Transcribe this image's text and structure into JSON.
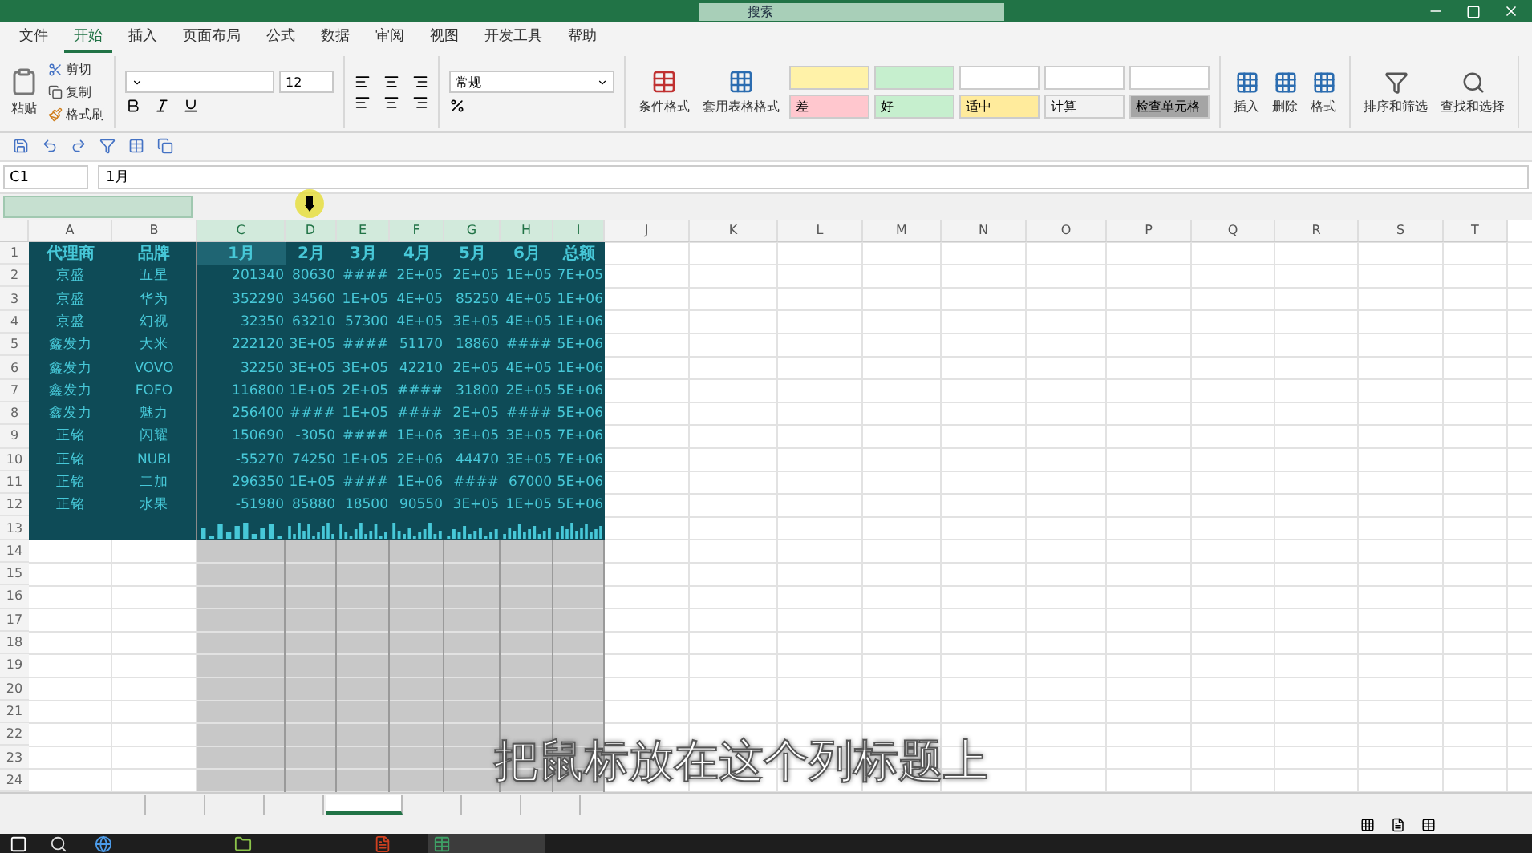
{
  "title_bar": {
    "search_placeholder": "搜索"
  },
  "ribbon_tabs": [
    {
      "label": "文件",
      "selected": false
    },
    {
      "label": "开始",
      "selected": true
    },
    {
      "label": "插入",
      "selected": false
    },
    {
      "label": "页面布局",
      "selected": false
    },
    {
      "label": "公式",
      "selected": false
    },
    {
      "label": "数据",
      "selected": false
    },
    {
      "label": "审阅",
      "selected": false
    },
    {
      "label": "视图",
      "selected": false
    },
    {
      "label": "开发工具",
      "selected": false
    },
    {
      "label": "帮助",
      "selected": false
    }
  ],
  "clipboard": {
    "paste": "粘贴",
    "cut": "剪切",
    "copy": "复制",
    "painter": "格式刷"
  },
  "font": {
    "size": "12"
  },
  "number": {
    "format": "常规"
  },
  "style_buttons": [
    "条件格式",
    "套用表格格式"
  ],
  "cell_styles": [
    {
      "color": "#fff2a8"
    },
    {
      "color": "#c6efce"
    },
    {
      "color": "#ffffff"
    },
    {
      "color": "#ffffff"
    },
    {
      "color": "#ffffff"
    },
    {
      "label": "差",
      "color": "#ffc7ce"
    },
    {
      "label": "好",
      "color": "#c6efce"
    },
    {
      "label": "适中",
      "color": "#ffeb9c"
    },
    {
      "label": "计算",
      "color": "#f2f2f2"
    },
    {
      "label": "检查单元格",
      "color": "#a5a5a5"
    }
  ],
  "cells_group": [
    "插入",
    "删除",
    "格式"
  ],
  "editing_group": [
    "排序和筛选",
    "查找和选择"
  ],
  "formula_bar": {
    "name_box": "C1",
    "value": "1月"
  },
  "columns": [
    {
      "label": "A",
      "selected": false
    },
    {
      "label": "B",
      "selected": false
    },
    {
      "label": "C",
      "selected": true
    },
    {
      "label": "D",
      "selected": true
    },
    {
      "label": "E",
      "selected": true
    },
    {
      "label": "F",
      "selected": true
    },
    {
      "label": "G",
      "selected": true
    },
    {
      "label": "H",
      "selected": true
    },
    {
      "label": "I",
      "selected": true
    },
    {
      "label": "J",
      "selected": false
    },
    {
      "label": "K",
      "selected": false
    },
    {
      "label": "L",
      "selected": false
    },
    {
      "label": "M",
      "selected": false
    },
    {
      "label": "N",
      "selected": false
    },
    {
      "label": "O",
      "selected": false
    },
    {
      "label": "P",
      "selected": false
    },
    {
      "label": "Q",
      "selected": false
    },
    {
      "label": "R",
      "selected": false
    },
    {
      "label": "S",
      "selected": false
    },
    {
      "label": "T",
      "selected": false
    }
  ],
  "rows": [
    {
      "number": "1",
      "kind": "data",
      "cells": [
        "代理商",
        "品牌",
        "1月",
        "2月",
        "3月",
        "4月",
        "5月",
        "6月",
        "总额"
      ]
    },
    {
      "number": "2",
      "kind": "data",
      "cells": [
        "京盛",
        "五星",
        "201340",
        "80630",
        "####",
        "2E+05",
        "2E+05",
        "1E+05",
        "7E+05"
      ]
    },
    {
      "number": "3",
      "kind": "data",
      "cells": [
        "京盛",
        "华为",
        "352290",
        "34560",
        "1E+05",
        "4E+05",
        "85250",
        "4E+05",
        "1E+06"
      ]
    },
    {
      "number": "4",
      "kind": "data",
      "cells": [
        "京盛",
        "幻视",
        "32350",
        "63210",
        "57300",
        "4E+05",
        "3E+05",
        "4E+05",
        "1E+06"
      ]
    },
    {
      "number": "5",
      "kind": "data",
      "cells": [
        "鑫发力",
        "大米",
        "222120",
        "3E+05",
        "####",
        "51170",
        "18860",
        "####",
        "5E+06"
      ]
    },
    {
      "number": "6",
      "kind": "data",
      "cells": [
        "鑫发力",
        "VOVO",
        "32250",
        "3E+05",
        "3E+05",
        "42210",
        "2E+05",
        "4E+05",
        "1E+06"
      ]
    },
    {
      "number": "7",
      "kind": "data",
      "cells": [
        "鑫发力",
        "FOFO",
        "116800",
        "1E+05",
        "2E+05",
        "####",
        "31800",
        "2E+05",
        "5E+06"
      ]
    },
    {
      "number": "8",
      "kind": "data",
      "cells": [
        "鑫发力",
        "魅力",
        "256400",
        "####",
        "1E+05",
        "####",
        "2E+05",
        "####",
        "5E+06"
      ]
    },
    {
      "number": "9",
      "kind": "data",
      "cells": [
        "正铭",
        "闪耀",
        "150690",
        "-3050",
        "####",
        "1E+06",
        "3E+05",
        "3E+05",
        "7E+06"
      ]
    },
    {
      "number": "10",
      "kind": "data",
      "cells": [
        "正铭",
        "NUBI",
        "-55270",
        "74250",
        "1E+05",
        "2E+06",
        "44470",
        "3E+05",
        "7E+06"
      ]
    },
    {
      "number": "11",
      "kind": "data",
      "cells": [
        "正铭",
        "二加",
        "296350",
        "1E+05",
        "####",
        "1E+06",
        "####",
        "67000",
        "5E+06"
      ]
    },
    {
      "number": "12",
      "kind": "data",
      "cells": [
        "正铭",
        "水果",
        "-51980",
        "85880",
        "18500",
        "90550",
        "3E+05",
        "1E+05",
        "5E+06"
      ]
    },
    {
      "number": "13",
      "kind": "sparkline"
    },
    {
      "number": "14",
      "kind": "empty"
    },
    {
      "number": "15",
      "kind": "empty"
    },
    {
      "number": "16",
      "kind": "empty"
    },
    {
      "number": "17",
      "kind": "empty"
    },
    {
      "number": "18",
      "kind": "empty"
    },
    {
      "number": "19",
      "kind": "empty"
    },
    {
      "number": "20",
      "kind": "empty"
    },
    {
      "number": "21",
      "kind": "empty"
    },
    {
      "number": "22",
      "kind": "empty"
    },
    {
      "number": "23",
      "kind": "empty"
    },
    {
      "number": "24",
      "kind": "empty"
    }
  ],
  "sheet_tabs": [
    {
      "selected": false
    },
    {
      "selected": false
    },
    {
      "selected": false
    },
    {
      "selected": false
    },
    {
      "selected": true
    },
    {
      "selected": false
    },
    {
      "selected": false
    },
    {
      "selected": false
    }
  ],
  "subtitle": "把鼠标放在这个列标题上"
}
